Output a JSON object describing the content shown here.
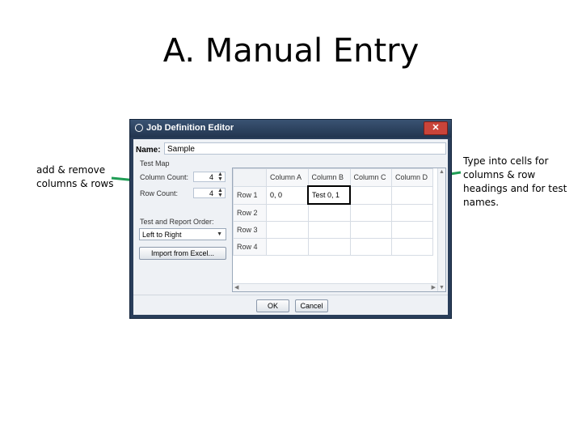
{
  "slide": {
    "title": "A. Manual Entry",
    "annotation_left": "add & remove columns & rows",
    "annotation_right": "Type into cells for columns & row headings and for test names."
  },
  "dialog": {
    "title": "Job Definition Editor",
    "close_label": "✕",
    "name_label": "Name:",
    "name_value": "Sample",
    "test_map_label": "Test Map",
    "column_count_label": "Column Count:",
    "column_count_value": "4",
    "row_count_label": "Row Count:",
    "row_count_value": "4",
    "order_label": "Test and Report Order:",
    "order_value": "Left to Right",
    "import_button": "Import from Excel...",
    "ok_button": "OK",
    "cancel_button": "Cancel"
  },
  "grid": {
    "columns": [
      "Column A",
      "Column B",
      "Column C",
      "Column D"
    ],
    "rows": [
      {
        "header": "Row 1",
        "cells": [
          "0, 0",
          "Test 0, 1",
          "",
          ""
        ]
      },
      {
        "header": "Row 2",
        "cells": [
          "",
          "",
          "",
          ""
        ]
      },
      {
        "header": "Row 3",
        "cells": [
          "",
          "",
          "",
          ""
        ]
      },
      {
        "header": "Row 4",
        "cells": [
          "",
          "",
          "",
          ""
        ]
      }
    ]
  },
  "colors": {
    "arrow": "#1f9d55",
    "titlebar": "#2a3e5a"
  },
  "icons": {
    "title_icon": "check-circle-icon",
    "close": "close-icon",
    "spinner": "spinner-arrows-icon",
    "dropdown": "chevron-down-icon"
  }
}
